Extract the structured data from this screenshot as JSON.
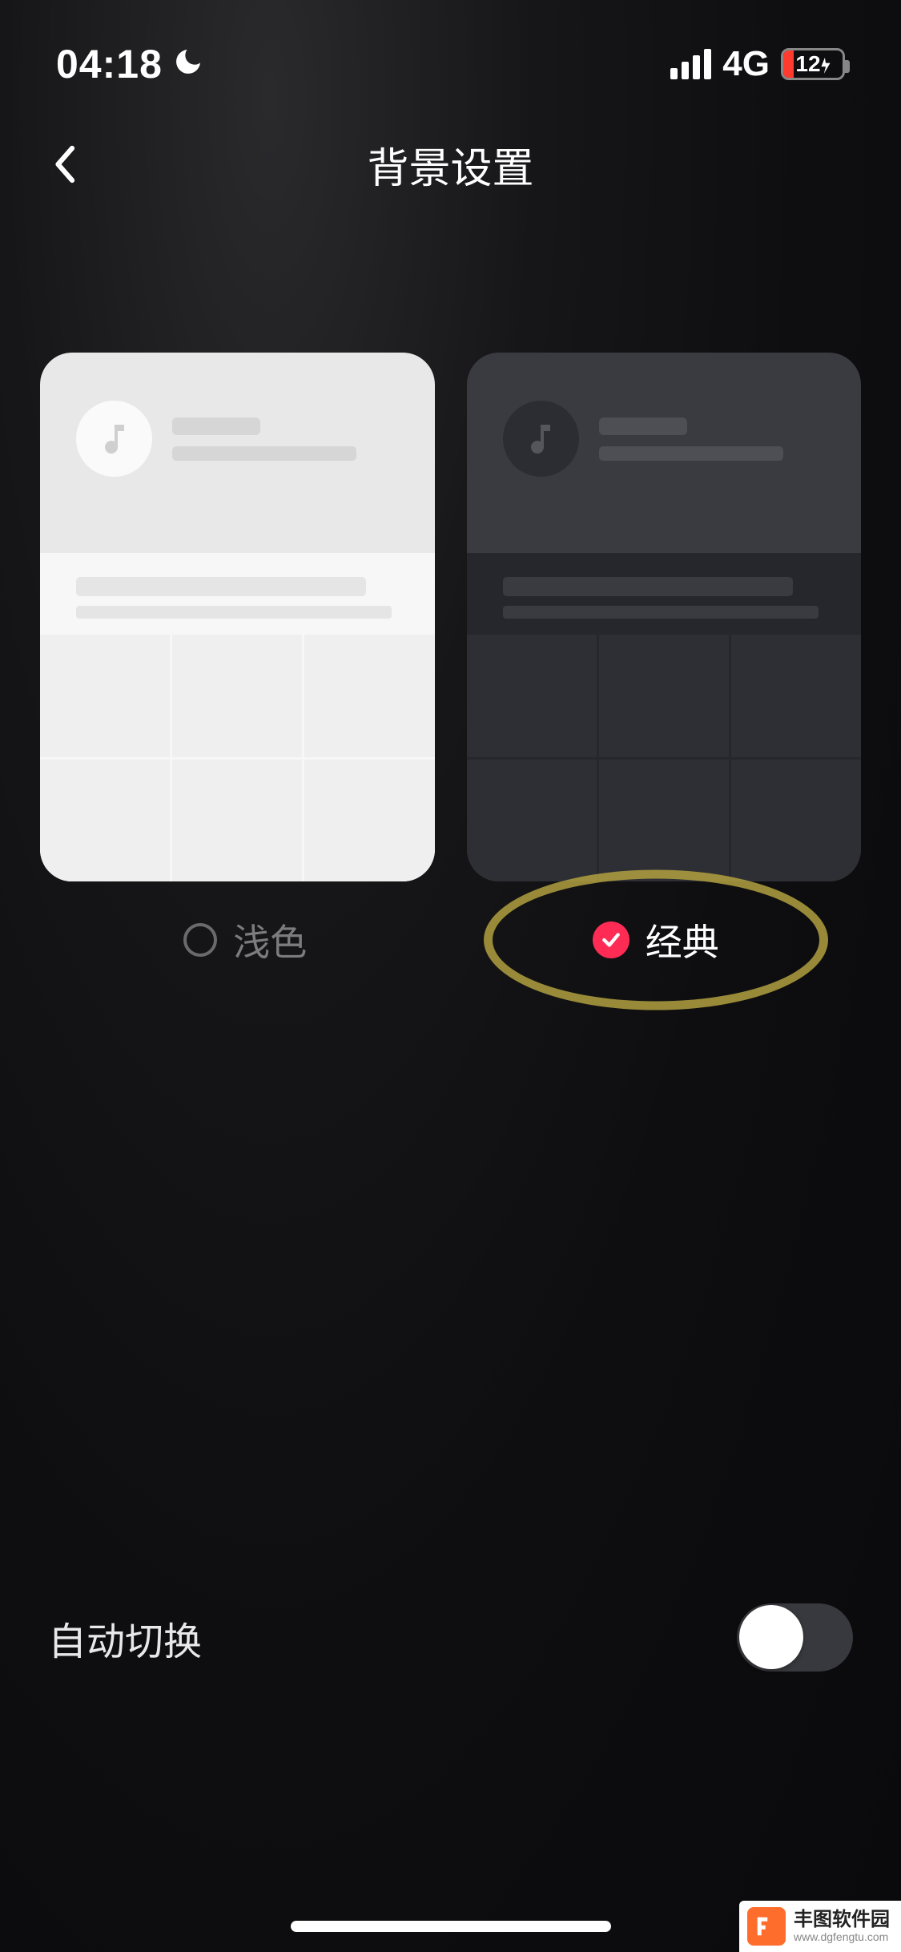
{
  "statusBar": {
    "time": "04:18",
    "network": "4G",
    "battery": "12"
  },
  "nav": {
    "title": "背景设置"
  },
  "options": {
    "light": {
      "label": "浅色",
      "selected": false
    },
    "dark": {
      "label": "经典",
      "selected": true
    }
  },
  "autoSwitch": {
    "label": "自动切换",
    "enabled": false
  },
  "watermark": {
    "name": "丰图软件园",
    "url": "www.dgfengtu.com"
  }
}
